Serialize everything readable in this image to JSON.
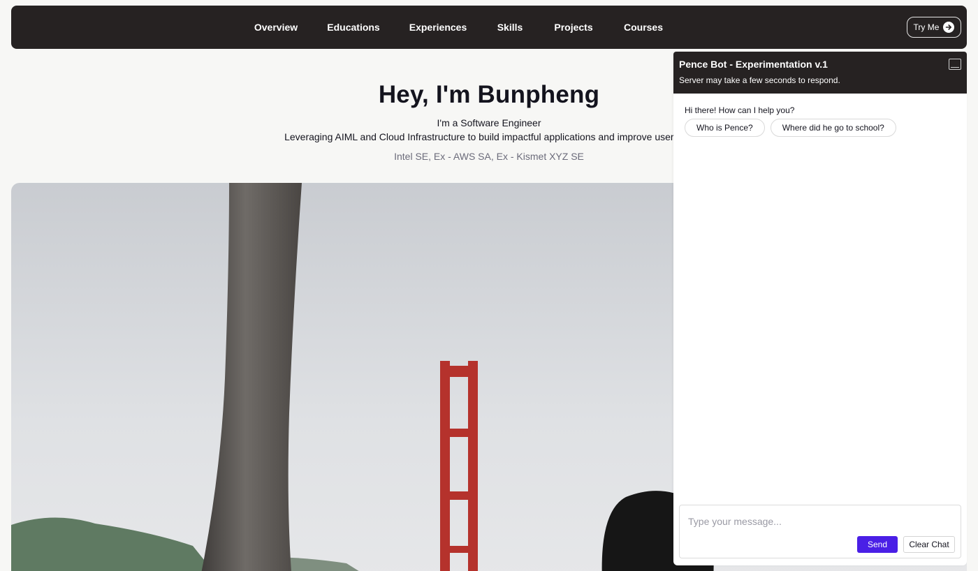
{
  "nav": {
    "items": [
      {
        "label": "Overview"
      },
      {
        "label": "Educations"
      },
      {
        "label": "Experiences"
      },
      {
        "label": "Skills"
      },
      {
        "label": "Projects"
      },
      {
        "label": "Courses"
      }
    ],
    "try_me_label": "Try Me",
    "try_me_icon": "arrow-right-icon"
  },
  "hero": {
    "title": "Hey, I'm Bunpheng",
    "role": "I'm a Software Engineer",
    "description": "Leveraging AIML and Cloud Infrastructure to build impactful applications and improve user's ex",
    "credentials": "Intel SE, Ex - AWS SA, Ex - Kismet XYZ SE"
  },
  "chat": {
    "title": "Pence Bot - Experimentation v.1",
    "subtitle": "Server may take a few seconds to respond.",
    "minimize_icon": "minimize-icon",
    "greeting": "Hi there! How can I help you?",
    "suggestions": [
      {
        "label": "Who is Pence?"
      },
      {
        "label": "Where did he go to school?"
      }
    ],
    "input_placeholder": "Type your message...",
    "send_label": "Send",
    "clear_label": "Clear Chat"
  },
  "colors": {
    "nav_bg": "#262222",
    "page_bg": "#f7f7f5",
    "send_button": "#4a1fe6"
  }
}
